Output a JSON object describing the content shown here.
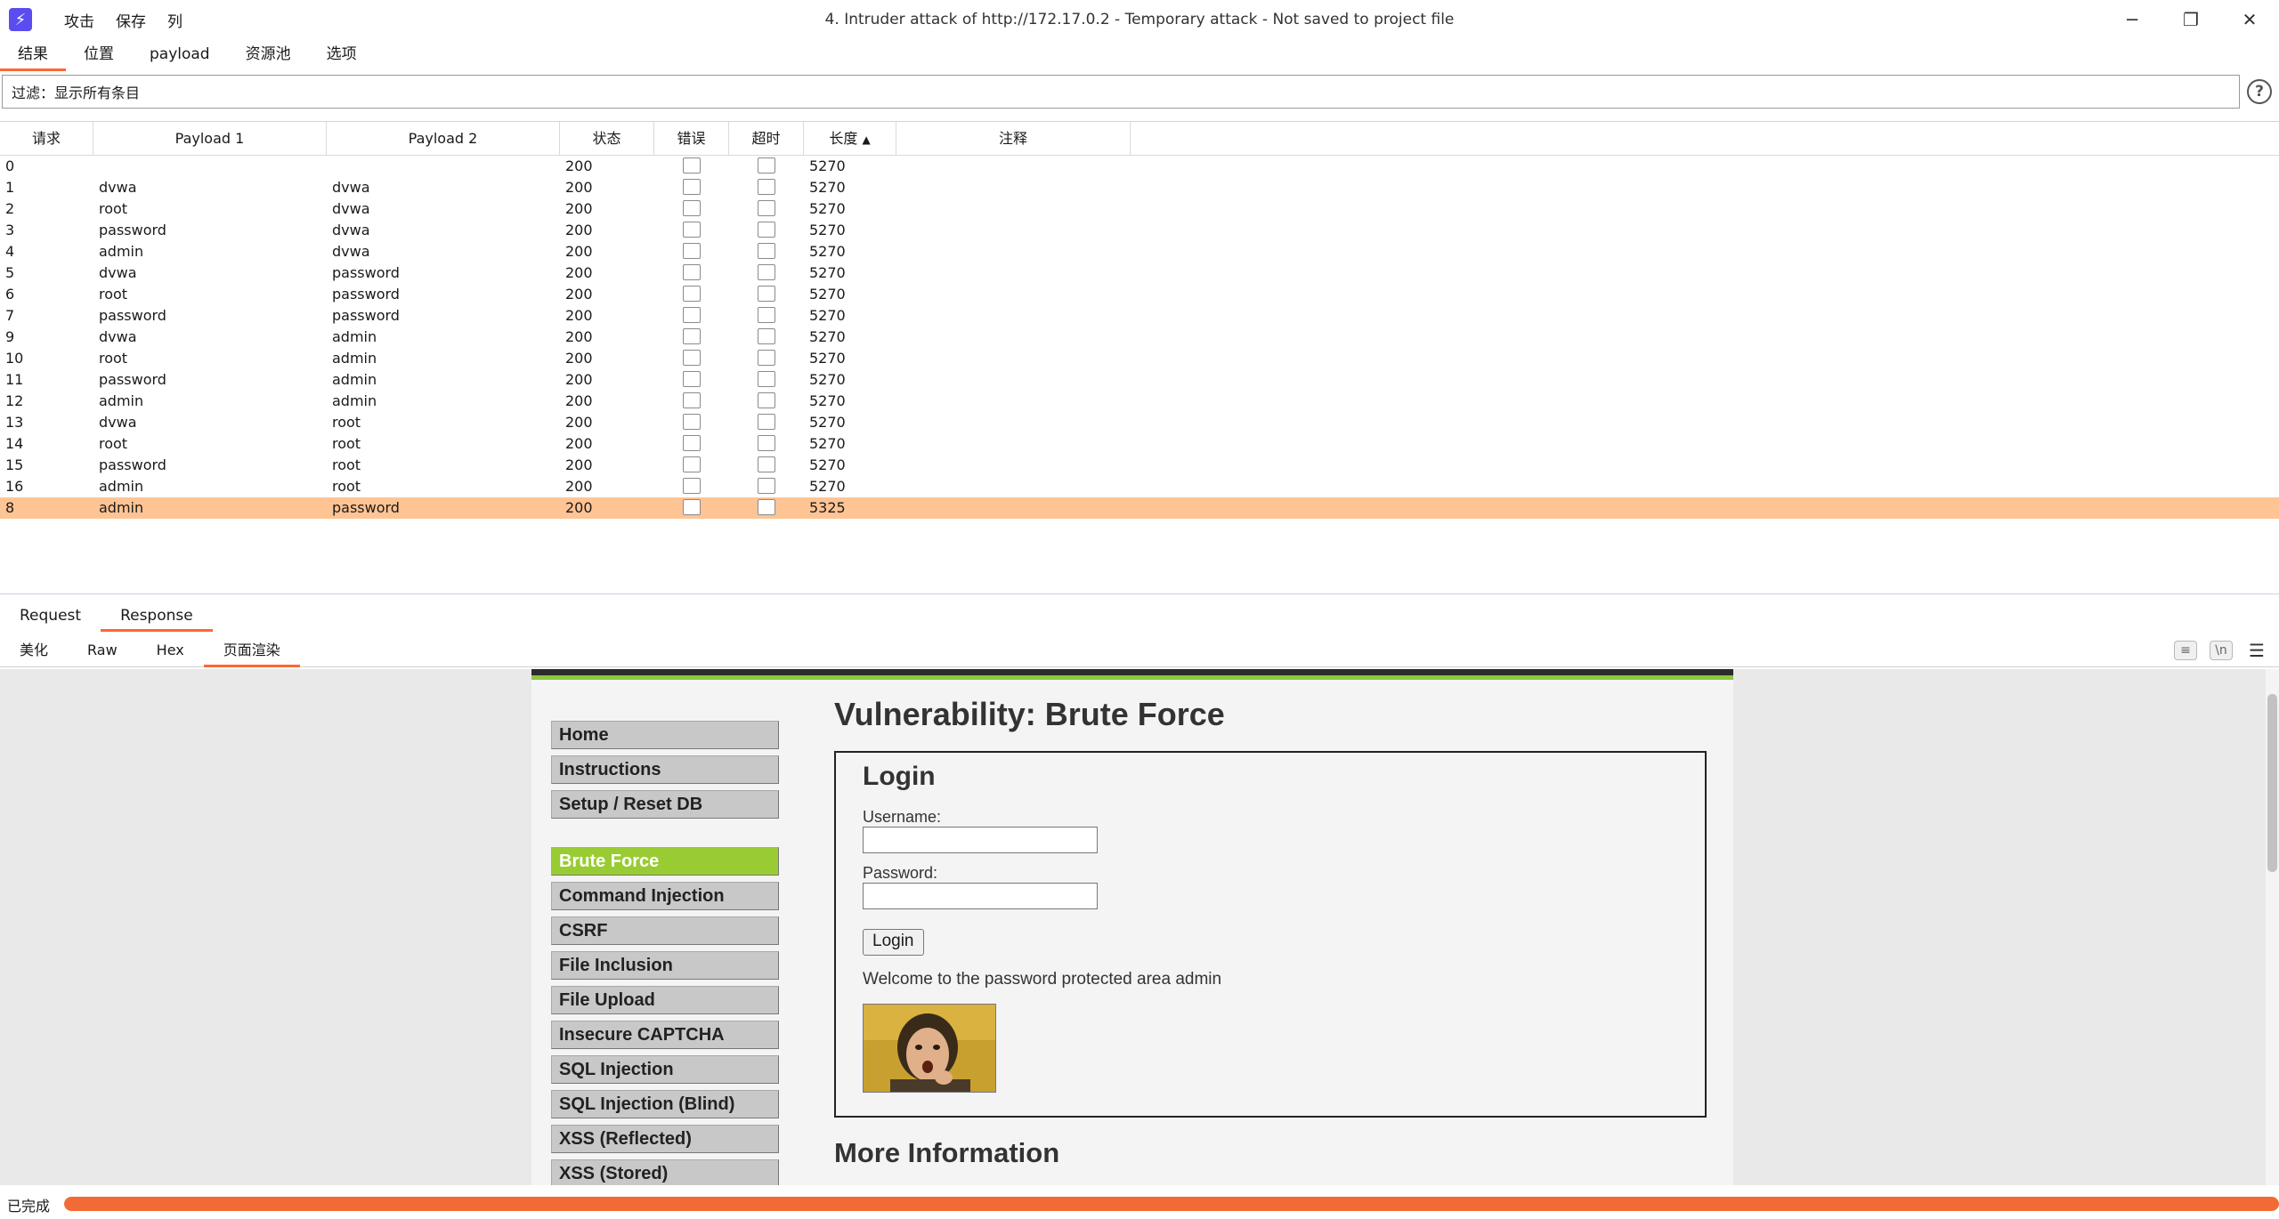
{
  "window": {
    "title": "4. Intruder attack of http://172.17.0.2 - Temporary attack - Not saved to project file",
    "menu": [
      "攻击",
      "保存",
      "列"
    ],
    "controls": [
      "minimize",
      "restore",
      "close"
    ]
  },
  "top_tabs": [
    {
      "label": "结果",
      "active": true
    },
    {
      "label": "位置",
      "active": false
    },
    {
      "label": "payload",
      "active": false
    },
    {
      "label": "资源池",
      "active": false
    },
    {
      "label": "选项",
      "active": false
    }
  ],
  "filter": {
    "text": "过滤：显示所有条目"
  },
  "table": {
    "columns": [
      "请求",
      "Payload 1",
      "Payload 2",
      "状态",
      "错误",
      "超时",
      "长度",
      "注释"
    ],
    "sort_column": "长度",
    "sort_direction": "ascending",
    "rows": [
      {
        "req": "0",
        "p1": "",
        "p2": "",
        "status": "200",
        "len": "5270"
      },
      {
        "req": "1",
        "p1": "dvwa",
        "p2": "dvwa",
        "status": "200",
        "len": "5270"
      },
      {
        "req": "2",
        "p1": "root",
        "p2": "dvwa",
        "status": "200",
        "len": "5270"
      },
      {
        "req": "3",
        "p1": "password",
        "p2": "dvwa",
        "status": "200",
        "len": "5270"
      },
      {
        "req": "4",
        "p1": "admin",
        "p2": "dvwa",
        "status": "200",
        "len": "5270"
      },
      {
        "req": "5",
        "p1": "dvwa",
        "p2": "password",
        "status": "200",
        "len": "5270"
      },
      {
        "req": "6",
        "p1": "root",
        "p2": "password",
        "status": "200",
        "len": "5270"
      },
      {
        "req": "7",
        "p1": "password",
        "p2": "password",
        "status": "200",
        "len": "5270"
      },
      {
        "req": "9",
        "p1": "dvwa",
        "p2": "admin",
        "status": "200",
        "len": "5270"
      },
      {
        "req": "10",
        "p1": "root",
        "p2": "admin",
        "status": "200",
        "len": "5270"
      },
      {
        "req": "11",
        "p1": "password",
        "p2": "admin",
        "status": "200",
        "len": "5270"
      },
      {
        "req": "12",
        "p1": "admin",
        "p2": "admin",
        "status": "200",
        "len": "5270"
      },
      {
        "req": "13",
        "p1": "dvwa",
        "p2": "root",
        "status": "200",
        "len": "5270"
      },
      {
        "req": "14",
        "p1": "root",
        "p2": "root",
        "status": "200",
        "len": "5270"
      },
      {
        "req": "15",
        "p1": "password",
        "p2": "root",
        "status": "200",
        "len": "5270"
      },
      {
        "req": "16",
        "p1": "admin",
        "p2": "root",
        "status": "200",
        "len": "5270"
      },
      {
        "req": "8",
        "p1": "admin",
        "p2": "password",
        "status": "200",
        "len": "5325",
        "selected": true
      }
    ]
  },
  "req_res_tabs": [
    {
      "label": "Request",
      "active": false
    },
    {
      "label": "Response",
      "active": true
    }
  ],
  "view_tabs": [
    {
      "label": "美化",
      "active": false
    },
    {
      "label": "Raw",
      "active": false
    },
    {
      "label": "Hex",
      "active": false
    },
    {
      "label": "页面渲染",
      "active": true
    }
  ],
  "view_icons": [
    "wrap-icon",
    "newline-icon",
    "hamburger-menu-icon"
  ],
  "dvwa": {
    "menu_top": [
      "Home",
      "Instructions",
      "Setup / Reset DB"
    ],
    "menu_vulns": [
      "Brute Force",
      "Command Injection",
      "CSRF",
      "File Inclusion",
      "File Upload",
      "Insecure CAPTCHA",
      "SQL Injection",
      "SQL Injection (Blind)",
      "XSS (Reflected)",
      "XSS (Stored)"
    ],
    "active_item": "Brute Force",
    "heading": "Vulnerability: Brute Force",
    "login_heading": "Login",
    "username_label": "Username:",
    "password_label": "Password:",
    "login_button": "Login",
    "welcome": "Welcome to the password protected area admin",
    "more_info": "More Information",
    "accent_color": "#99cc33"
  },
  "status": {
    "text": "已完成",
    "progress": 1.0
  },
  "colors": {
    "accent": "#ff6633",
    "selected_row": "#ffc494",
    "progress": "#f26a35"
  }
}
